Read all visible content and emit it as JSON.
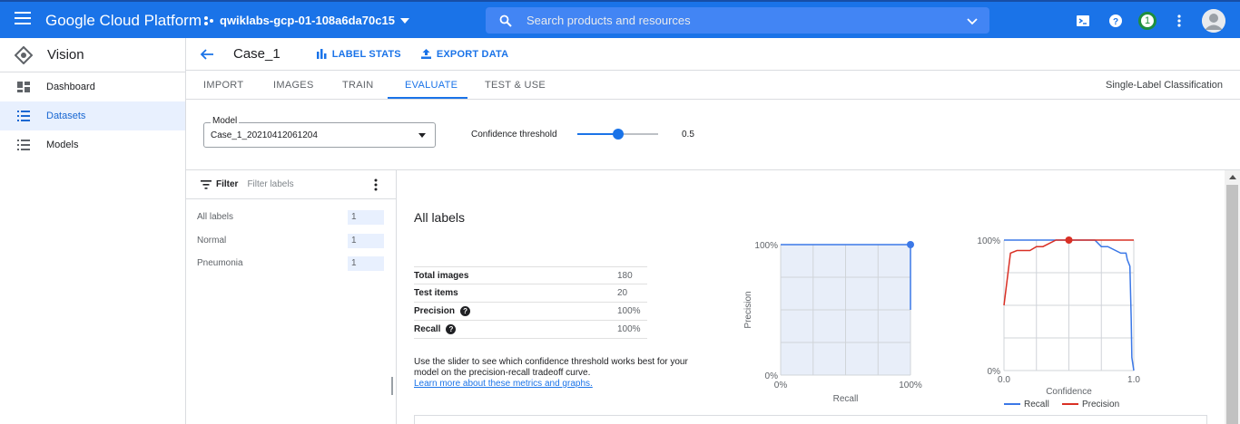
{
  "topbar": {
    "brand": "Google Cloud Platform",
    "project": "qwiklabs-gcp-01-108a6da70c15",
    "search_placeholder": "Search products and resources",
    "notification_count": "1"
  },
  "sidebar": {
    "product": "Vision",
    "items": [
      {
        "label": "Dashboard",
        "icon": "dashboard-icon",
        "active": false
      },
      {
        "label": "Datasets",
        "icon": "list-icon",
        "active": true
      },
      {
        "label": "Models",
        "icon": "list-icon",
        "active": false
      }
    ]
  },
  "header": {
    "title": "Case_1",
    "label_stats": "LABEL STATS",
    "export_data": "EXPORT DATA"
  },
  "tabs": {
    "items": [
      "IMPORT",
      "IMAGES",
      "TRAIN",
      "EVALUATE",
      "TEST & USE"
    ],
    "active": "EVALUATE",
    "classification_type": "Single-Label Classification"
  },
  "controls": {
    "model_label": "Model",
    "model_value": "Case_1_20210412061204",
    "confidence_label": "Confidence threshold",
    "confidence_value": "0.5",
    "confidence_fraction": 0.5
  },
  "filter": {
    "label": "Filter",
    "placeholder": "Filter labels",
    "labels": [
      {
        "name": "All labels",
        "count": "1"
      },
      {
        "name": "Normal",
        "count": "1"
      },
      {
        "name": "Pneumonia",
        "count": "1"
      }
    ]
  },
  "main": {
    "heading": "All labels",
    "stats": [
      {
        "key": "Total images",
        "value": "180",
        "help": false
      },
      {
        "key": "Test items",
        "value": "20",
        "help": false
      },
      {
        "key": "Precision",
        "value": "100%",
        "help": true
      },
      {
        "key": "Recall",
        "value": "100%",
        "help": true
      }
    ],
    "help_text": "Use the slider to see which confidence threshold works best for your model on the precision-recall tradeoff curve.",
    "help_link": "Learn more about these metrics and graphs."
  },
  "colors": {
    "accent": "#1a73e8",
    "recall_line": "#3b78e7",
    "precision_line": "#d93025"
  },
  "chart_data": [
    {
      "type": "area",
      "xlabel": "Recall",
      "ylabel": "Precision",
      "x_ticks": [
        "0%",
        "100%"
      ],
      "y_ticks": [
        "0%",
        "100%"
      ],
      "xlim": [
        0,
        1
      ],
      "ylim": [
        0,
        1
      ],
      "grid": true,
      "series": [
        {
          "x": [
            0,
            0.2,
            0.4,
            0.6,
            0.8,
            1.0,
            1.0
          ],
          "y": [
            1,
            1,
            1,
            1,
            1,
            1,
            0.5
          ]
        }
      ],
      "highlight_point": {
        "x": 1.0,
        "y": 1.0
      }
    },
    {
      "type": "line",
      "xlabel": "Confidence",
      "x_ticks": [
        "0.0",
        "1.0"
      ],
      "y_ticks": [
        "0%",
        "100%"
      ],
      "xlim": [
        0,
        1
      ],
      "ylim": [
        0,
        1
      ],
      "grid": true,
      "legend_position": "bottom",
      "series": [
        {
          "name": "Recall",
          "x": [
            0,
            0.05,
            0.1,
            0.2,
            0.3,
            0.4,
            0.5,
            0.6,
            0.7,
            0.75,
            0.8,
            0.9,
            0.94,
            0.95,
            0.97,
            0.98,
            0.985,
            1.0
          ],
          "y": [
            1,
            1,
            1,
            1,
            1,
            1,
            1,
            1,
            1,
            0.95,
            0.95,
            0.9,
            0.9,
            0.85,
            0.8,
            0.4,
            0.1,
            0
          ]
        },
        {
          "name": "Precision",
          "x": [
            0,
            0.05,
            0.1,
            0.2,
            0.25,
            0.3,
            0.4,
            0.5,
            0.6,
            0.7,
            0.8,
            0.9,
            0.95,
            1.0
          ],
          "y": [
            0.5,
            0.9,
            0.92,
            0.92,
            0.95,
            0.95,
            1,
            1,
            1,
            1,
            1,
            1,
            1,
            1
          ]
        }
      ],
      "highlight_point": {
        "x": 0.5,
        "y": 1.0
      }
    }
  ]
}
